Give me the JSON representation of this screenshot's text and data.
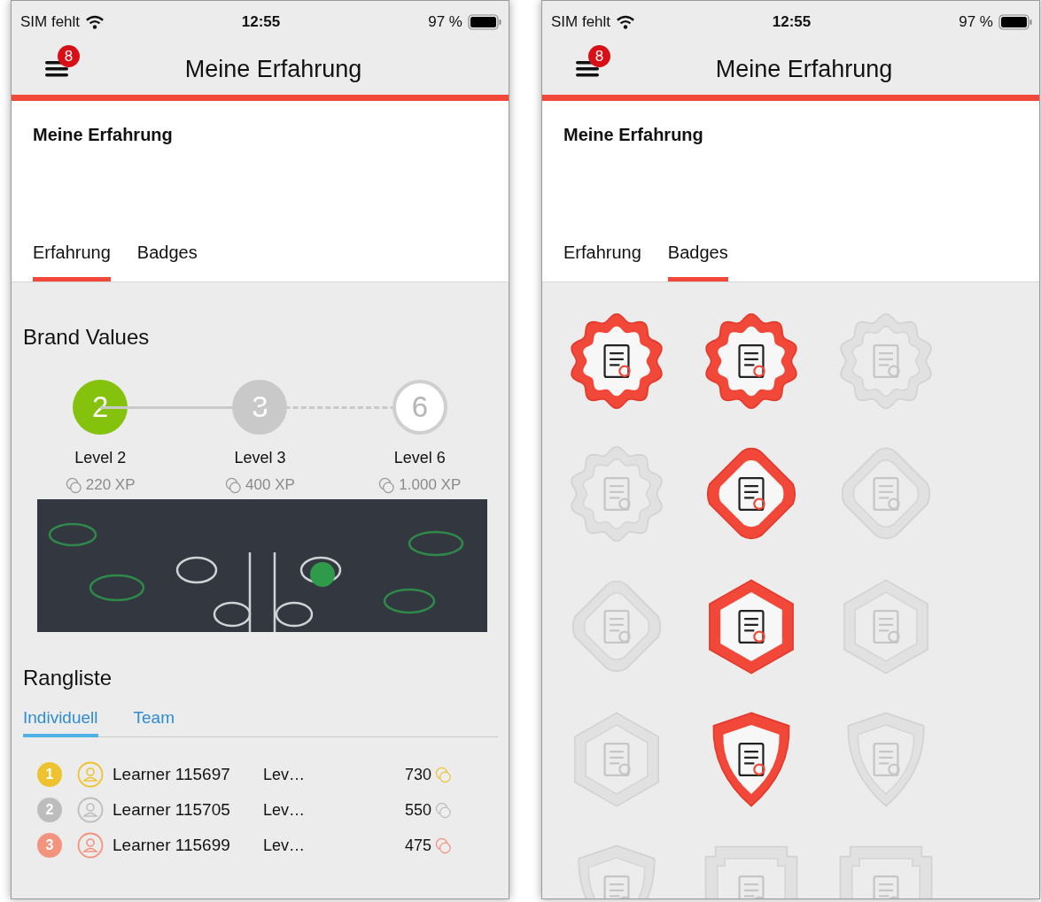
{
  "screens": [
    {
      "kind": "experience",
      "status_bar": {
        "carrier": "SIM fehlt",
        "time": "12:55",
        "battery": "97 %"
      },
      "header": {
        "title": "Meine Erfahrung",
        "notification_count": "8"
      },
      "page_title": "Meine Erfahrung",
      "tabs": [
        {
          "label": "Erfahrung",
          "selected": true
        },
        {
          "label": "Badges",
          "selected": false
        }
      ],
      "brand_values": {
        "title": "Brand Values",
        "levels": [
          {
            "number": "2",
            "label": "Level 2",
            "xp": "220 XP",
            "kind": "reached"
          },
          {
            "number": "3",
            "label": "Level 3",
            "xp": "400 XP",
            "kind": "next"
          },
          {
            "number": "6",
            "label": "Level 6",
            "xp": "1.000 XP",
            "kind": "goal"
          }
        ]
      },
      "leaderboard": {
        "title": "Rangliste",
        "tabs": [
          {
            "label": "Individuell",
            "selected": true
          },
          {
            "label": "Team",
            "selected": false
          }
        ],
        "rows": [
          {
            "rank": "1",
            "color": "#efc230",
            "name": "Learner 115697",
            "level": "Lev…",
            "score": "730"
          },
          {
            "rank": "2",
            "color": "#bdbdbd",
            "name": "Learner 115705",
            "level": "Lev…",
            "score": "550"
          },
          {
            "rank": "3",
            "color": "#f2937d",
            "name": "Learner 115699",
            "level": "Lev…",
            "score": "475"
          }
        ]
      }
    },
    {
      "kind": "badges",
      "status_bar": {
        "carrier": "SIM fehlt",
        "time": "12:55",
        "battery": "97 %"
      },
      "header": {
        "title": "Meine Erfahrung",
        "notification_count": "8"
      },
      "page_title": "Meine Erfahrung",
      "tabs": [
        {
          "label": "Erfahrung",
          "selected": false
        },
        {
          "label": "Badges",
          "selected": true
        }
      ],
      "badges": [
        {
          "kind": "scallop",
          "earned": true
        },
        {
          "kind": "scallop",
          "earned": true
        },
        {
          "kind": "scallop",
          "earned": false
        },
        {
          "kind": "scallop",
          "earned": false
        },
        {
          "kind": "diamond",
          "earned": true
        },
        {
          "kind": "diamond",
          "earned": false
        },
        {
          "kind": "diamond",
          "earned": false
        },
        {
          "kind": "hexagon",
          "earned": true
        },
        {
          "kind": "hexagon",
          "earned": false
        },
        {
          "kind": "hexagon",
          "earned": false
        },
        {
          "kind": "shield",
          "earned": true
        },
        {
          "kind": "shield",
          "earned": false
        },
        {
          "kind": "shield",
          "earned": false
        },
        {
          "kind": "frame",
          "earned": false
        },
        {
          "kind": "frame",
          "earned": false
        }
      ]
    }
  ]
}
